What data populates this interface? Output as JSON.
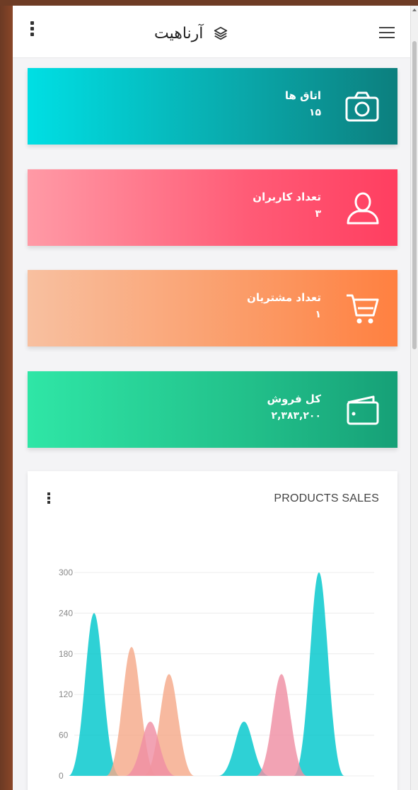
{
  "topbar": {
    "title": "آرناهیت",
    "menu_icon": "hamburger-icon",
    "more_icon": "kebab-icon",
    "brand_icon": "layers-icon"
  },
  "cards": [
    {
      "label": "اتاق ها",
      "value": "۱۵",
      "icon": "camera-icon"
    },
    {
      "label": "تعداد کاربران",
      "value": "۳",
      "icon": "user-icon"
    },
    {
      "label": "تعداد مشتریان",
      "value": "۱",
      "icon": "cart-icon"
    },
    {
      "label": "کل فروش",
      "value": "۲,۳۸۳,۲۰۰",
      "icon": "wallet-icon"
    }
  ],
  "colors": {
    "teal": "#00c7cc",
    "salmon": "#f5a98a",
    "pink": "#ef8fa3"
  },
  "chart": {
    "title": "PRODUCTS SALES"
  },
  "chart_data": {
    "type": "area",
    "ylim": [
      0,
      300
    ],
    "yticks": [
      "0",
      "60",
      "120",
      "180",
      "240",
      "300"
    ],
    "grid": true,
    "series": [
      {
        "color": "#00c7cc",
        "peaks": [
          {
            "x": 1,
            "y": 240
          },
          {
            "x": 5,
            "y": 80
          },
          {
            "x": 7,
            "y": 300
          }
        ]
      },
      {
        "color": "#f5a98a",
        "peaks": [
          {
            "x": 2,
            "y": 190
          },
          {
            "x": 3,
            "y": 150
          }
        ]
      },
      {
        "color": "#ef8fa3",
        "peaks": [
          {
            "x": 2.5,
            "y": 80
          },
          {
            "x": 6,
            "y": 150
          }
        ]
      }
    ]
  }
}
